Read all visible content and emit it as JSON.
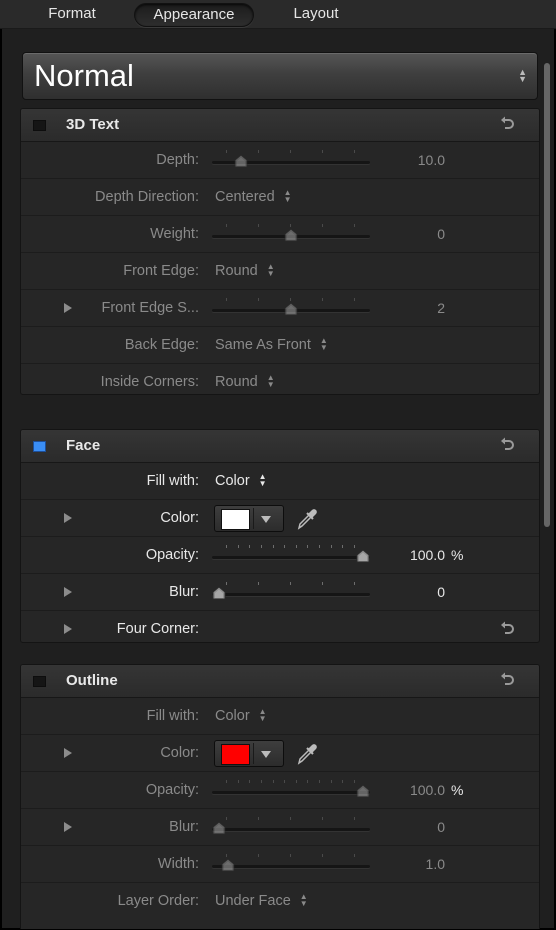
{
  "tabs": [
    {
      "label": "Format"
    },
    {
      "label": "Appearance"
    },
    {
      "label": "Layout"
    }
  ],
  "preset": {
    "value": "Normal"
  },
  "groups": {
    "text3d": {
      "title": "3D Text",
      "enabled": false,
      "rows": [
        {
          "label": "Depth:",
          "type": "slider",
          "value": "10.0",
          "position": 0.15
        },
        {
          "label": "Depth Direction:",
          "type": "popup",
          "value": "Centered"
        },
        {
          "label": "Weight:",
          "type": "slider",
          "value": "0",
          "position": 0.5
        },
        {
          "label": "Front Edge:",
          "type": "popup",
          "value": "Round"
        },
        {
          "label": "Front Edge S...",
          "type": "slider",
          "value": "2",
          "position": 0.5,
          "disclosure": true
        },
        {
          "label": "Back Edge:",
          "type": "popup",
          "value": "Same As Front"
        },
        {
          "label": "Inside Corners:",
          "type": "popup",
          "value": "Round"
        }
      ]
    },
    "face": {
      "title": "Face",
      "enabled": true,
      "rows": [
        {
          "label": "Fill with:",
          "type": "popup",
          "value": "Color"
        },
        {
          "label": "Color:",
          "type": "color",
          "color": "#ffffff",
          "disclosure": true
        },
        {
          "label": "Opacity:",
          "type": "slider",
          "value": "100.0",
          "unit": "%",
          "position": 1.0
        },
        {
          "label": "Blur:",
          "type": "slider",
          "value": "0",
          "position": 0.0,
          "disclosure": true
        },
        {
          "label": "Four Corner:",
          "type": "reset",
          "disclosure": true
        }
      ]
    },
    "outline": {
      "title": "Outline",
      "enabled": false,
      "rows": [
        {
          "label": "Fill with:",
          "type": "popup",
          "value": "Color"
        },
        {
          "label": "Color:",
          "type": "color",
          "color": "#ff0000",
          "disclosure": true
        },
        {
          "label": "Opacity:",
          "type": "slider",
          "value": "100.0",
          "unit": "%",
          "position": 1.0
        },
        {
          "label": "Blur:",
          "type": "slider",
          "value": "0",
          "position": 0.0,
          "disclosure": true
        },
        {
          "label": "Width:",
          "type": "slider",
          "value": "1.0",
          "position": 0.06
        },
        {
          "label": "Layer Order:",
          "type": "popup",
          "value": "Under Face"
        }
      ]
    }
  },
  "colors": {
    "accent": "#3a8ef5",
    "panel": "#262626",
    "background": "#1f1f1f"
  }
}
